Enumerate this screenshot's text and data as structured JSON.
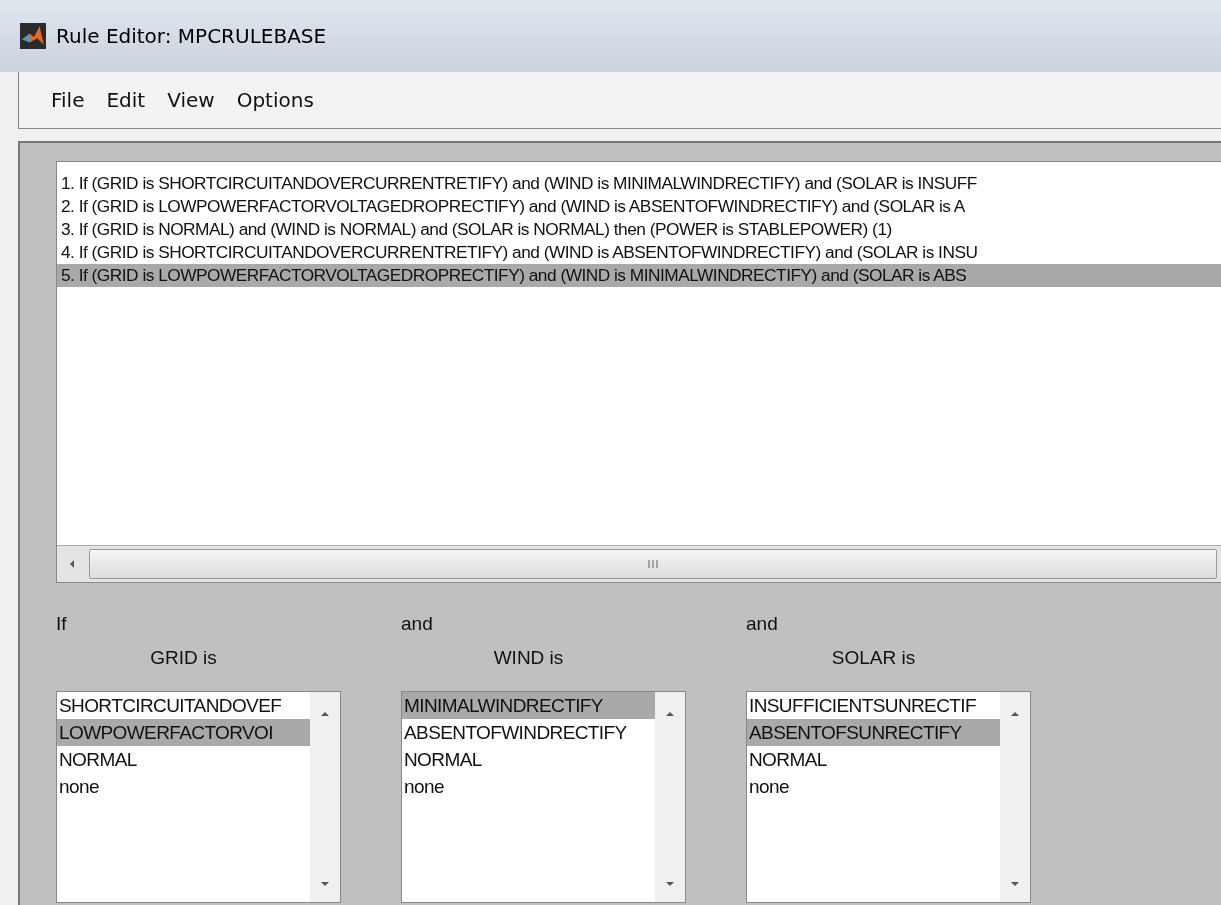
{
  "window": {
    "title": "Rule Editor: MPCRULEBASE"
  },
  "menu": [
    "File",
    "Edit",
    "View",
    "Options"
  ],
  "rules": [
    {
      "text": "1. If (GRID is SHORTCIRCUITANDOVERCURRENTRETIFY) and (WIND is MINIMALWINDRECTIFY) and (SOLAR is INSUFF",
      "selected": false
    },
    {
      "text": "2. If (GRID is LOWPOWERFACTORVOLTAGEDROPRECTIFY) and (WIND is ABSENTOFWINDRECTIFY) and (SOLAR is A",
      "selected": false
    },
    {
      "text": "3. If (GRID is NORMAL) and (WIND is NORMAL) and (SOLAR is NORMAL) then (POWER is STABLEPOWER) (1)",
      "selected": false
    },
    {
      "text": "4. If (GRID is SHORTCIRCUITANDOVERCURRENTRETIFY) and (WIND is ABSENTOFWINDRECTIFY) and (SOLAR is INSU",
      "selected": false
    },
    {
      "text": "5. If (GRID is LOWPOWERFACTORVOLTAGEDROPRECTIFY) and (WIND is MINIMALWINDRECTIFY) and (SOLAR is ABS",
      "selected": true
    }
  ],
  "inputs": [
    {
      "connector": "If",
      "label": "GRID is",
      "options": [
        {
          "text": "SHORTCIRCUITANDOVEF",
          "selected": false
        },
        {
          "text": "LOWPOWERFACTORVOI",
          "selected": true
        },
        {
          "text": "NORMAL",
          "selected": false
        },
        {
          "text": "none",
          "selected": false
        }
      ]
    },
    {
      "connector": "and",
      "label": "WIND is",
      "options": [
        {
          "text": "MINIMALWINDRECTIFY",
          "selected": true
        },
        {
          "text": "ABSENTOFWINDRECTIFY",
          "selected": false
        },
        {
          "text": "NORMAL",
          "selected": false
        },
        {
          "text": "none",
          "selected": false
        }
      ]
    },
    {
      "connector": "and",
      "label": "SOLAR is",
      "options": [
        {
          "text": "INSUFFICIENTSUNRECTIF",
          "selected": false
        },
        {
          "text": "ABSENTOFSUNRECTIFY",
          "selected": true
        },
        {
          "text": "NORMAL",
          "selected": false
        },
        {
          "text": "none",
          "selected": false
        }
      ]
    }
  ]
}
